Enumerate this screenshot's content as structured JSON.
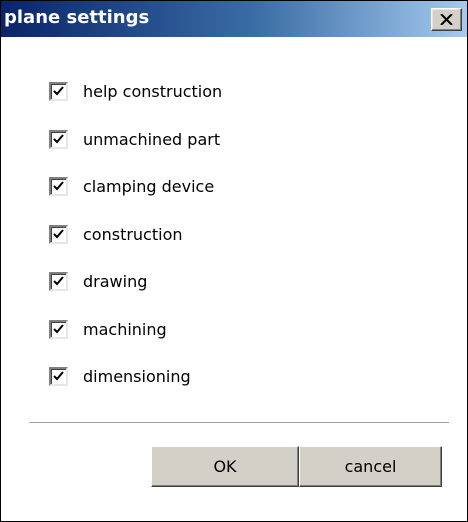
{
  "window": {
    "title": "plane settings",
    "close_icon": "close-x-icon"
  },
  "options": [
    {
      "label": "help construction",
      "checked": true
    },
    {
      "label": "unmachined part",
      "checked": true
    },
    {
      "label": "clamping device",
      "checked": true
    },
    {
      "label": "construction",
      "checked": true
    },
    {
      "label": "drawing",
      "checked": true
    },
    {
      "label": "machining",
      "checked": true
    },
    {
      "label": "dimensioning",
      "checked": true
    }
  ],
  "buttons": {
    "ok_label": "OK",
    "cancel_label": "cancel"
  },
  "colors": {
    "titlebar_start": "#0a246a",
    "titlebar_end": "#a6caf0",
    "button_face": "#d4d0c8"
  }
}
